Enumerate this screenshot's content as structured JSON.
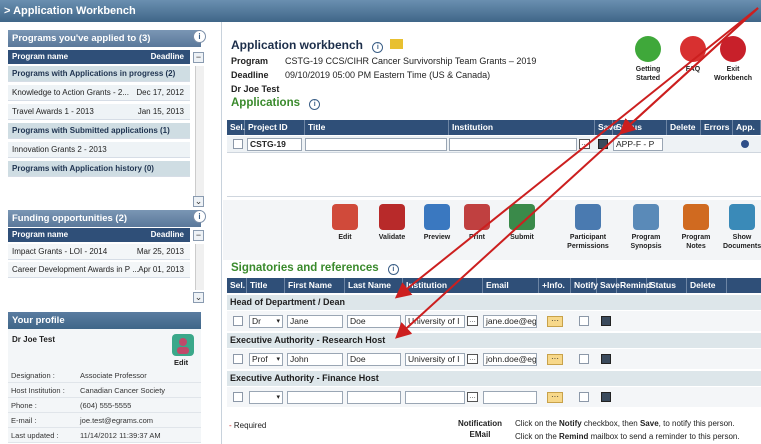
{
  "window": {
    "title": "> Application Workbench"
  },
  "left": {
    "programs": {
      "title": "Programs you've applied to (3)",
      "col_name": "Program name",
      "col_deadline": "Deadline",
      "rows": [
        {
          "type": "group",
          "name": "Programs with Applications in progress (2)",
          "deadline": ""
        },
        {
          "type": "item",
          "name": "Knowledge to Action Grants - 2...",
          "deadline": "Dec 17, 2012"
        },
        {
          "type": "item",
          "name": "Travel Awards 1 - 2013",
          "deadline": "Jan 15, 2013"
        },
        {
          "type": "group",
          "name": "Programs with Submitted applications (1)",
          "deadline": ""
        },
        {
          "type": "item",
          "name": "Innovation Grants 2 - 2013",
          "deadline": ""
        },
        {
          "type": "group",
          "name": "Programs with Application history (0)",
          "deadline": ""
        }
      ]
    },
    "funding": {
      "title": "Funding opportunities (2)",
      "col_name": "Program name",
      "col_deadline": "Deadline",
      "rows": [
        {
          "name": "Impact Grants - LOI - 2014",
          "deadline": "Mar 25, 2013"
        },
        {
          "name": "Career Development Awards in P ...",
          "deadline": "Apr 01, 2013"
        }
      ]
    },
    "profile": {
      "title": "Your profile",
      "name": "Dr Joe Test",
      "edit_label": "Edit",
      "fields": [
        {
          "label": "Designation :",
          "value": "Associate Professor"
        },
        {
          "label": "Host Institution :",
          "value": "Canadian Cancer Society"
        },
        {
          "label": "Phone :",
          "value": "(604) 555-5555"
        },
        {
          "label": "E-mail :",
          "value": "joe.test@egrams.com"
        },
        {
          "label": "Last updated :",
          "value": "11/14/2012 11:39:37 AM"
        }
      ]
    }
  },
  "workbench": {
    "title": "Application workbench",
    "program_label": "Program",
    "program_value": "CSTG-19 CCS/CIHR Cancer Survivorship Team Grants – 2019",
    "deadline_label": "Deadline",
    "deadline_value": "09/10/2019 05:00 PM Eastern Time (US & Canada)",
    "user": "Dr Joe Test",
    "top_buttons": [
      {
        "label": "Getting Started",
        "color": "#3fa83a"
      },
      {
        "label": "FAQ",
        "color": "#d83030"
      },
      {
        "label": "Exit Workbench",
        "color": "#c8202a"
      }
    ]
  },
  "applications": {
    "title": "Applications",
    "columns": [
      "Sel.",
      "Project ID",
      "Title",
      "Institution",
      "Save",
      "Status",
      "Delete",
      "Errors",
      "App."
    ],
    "row": {
      "project_id": "CSTG-19",
      "status": "APP-F - P"
    }
  },
  "toolbar": {
    "left": [
      {
        "label": "Edit",
        "color": "#d04a3a"
      },
      {
        "label": "Validate",
        "color": "#b82a2a"
      },
      {
        "label": "Preview",
        "color": "#3a78c0"
      },
      {
        "label": "Print",
        "color": "#c04040"
      },
      {
        "label": "Submit",
        "color": "#3a8a4a"
      }
    ],
    "right": [
      {
        "label": "Participant Permissions",
        "color": "#4a7ab0"
      },
      {
        "label": "Program Synopsis",
        "color": "#5a8ab8"
      },
      {
        "label": "Program Notes",
        "color": "#d06a20"
      },
      {
        "label": "Show Documents",
        "color": "#3a8ab8"
      }
    ]
  },
  "signatories": {
    "title": "Signatories and references",
    "columns": [
      "Sel.",
      "Title",
      "First Name",
      "Last Name",
      "Institution",
      "Email",
      "+Info.",
      "Notify",
      "Save",
      "Remind",
      "Status",
      "Delete"
    ],
    "groups": [
      {
        "name": "Head of Department / Dean",
        "title": "Dr",
        "first": "Jane",
        "last": "Doe",
        "institution": "University of I",
        "email": "jane.doe@egra"
      },
      {
        "name": "Executive Authority - Research Host",
        "title": "Prof",
        "first": "John",
        "last": "Doe",
        "institution": "University of I",
        "email": "john.doe@egra"
      },
      {
        "name": "Executive Authority - Finance Host",
        "title": "",
        "first": "",
        "last": "",
        "institution": "",
        "email": ""
      }
    ]
  },
  "footer": {
    "required": "- Required",
    "notification_label": "Notification",
    "email_label": "EMail",
    "notify_text_prefix": "Click on the ",
    "notify_bold": "Notify",
    "notify_text_mid": " checkbox, then ",
    "save_bold": "Save",
    "notify_text_suffix": ", to notify this person.",
    "remind_text_prefix": "Click on the ",
    "remind_bold": "Remind",
    "remind_text_suffix": " mailbox to send a reminder to this person."
  },
  "colors": {
    "header_blue": "#2f4f78",
    "accent_green": "#3a8a2c",
    "arrow_red": "#cc1f1f"
  }
}
